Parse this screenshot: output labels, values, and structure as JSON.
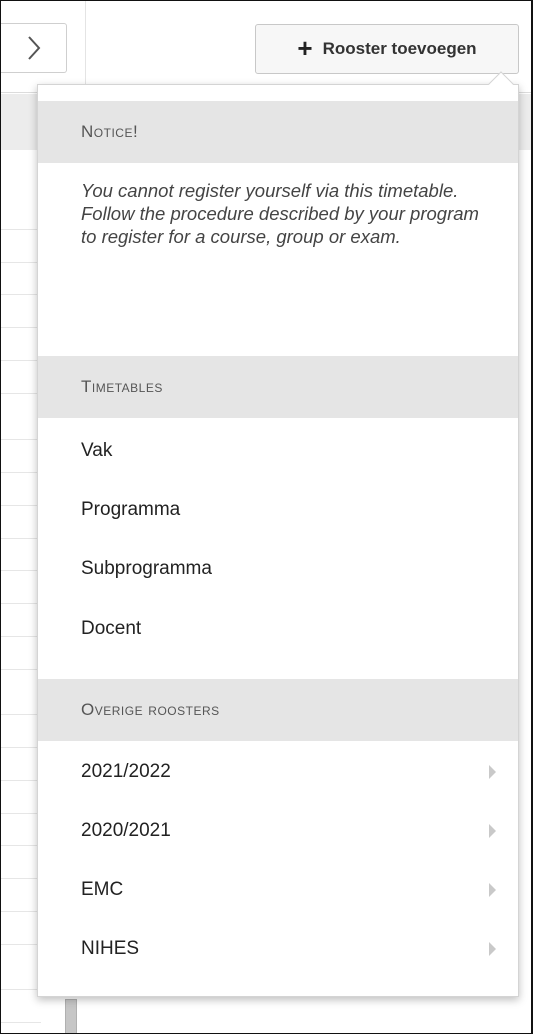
{
  "toolbar": {
    "next_icon": "chevron-right-icon",
    "add_button_label": "Rooster toevoegen",
    "add_icon": "+"
  },
  "dropdown": {
    "notice": {
      "heading": "Notice!",
      "text": "You cannot register yourself via this timetable. Follow the procedure described by your program to register for a course, group or exam."
    },
    "timetables": {
      "heading": "Timetables",
      "items": [
        {
          "label": "Vak"
        },
        {
          "label": "Programma"
        },
        {
          "label": "Subprogramma"
        },
        {
          "label": "Docent"
        }
      ]
    },
    "other": {
      "heading": "Overige roosters",
      "items": [
        {
          "label": "2021/2022",
          "has_submenu": true
        },
        {
          "label": "2020/2021",
          "has_submenu": true
        },
        {
          "label": "EMC",
          "has_submenu": true
        },
        {
          "label": "NIHES",
          "has_submenu": true
        }
      ]
    }
  },
  "colors": {
    "section_bg": "#e5e5e5",
    "panel_border": "#d4d4d4",
    "submenu_arrow": "#c9c9c9"
  }
}
